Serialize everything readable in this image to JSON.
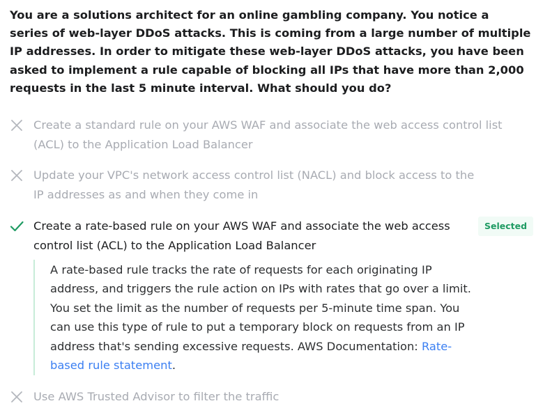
{
  "question": {
    "text": "You are a solutions architect for an online gambling company. You notice a series of web-layer DDoS attacks. This is coming from a large number of multiple IP addresses. In order to mitigate these web-layer DDoS attacks, you have been asked to implement a rule capable of blocking all IPs that have more than 2,000 requests in the last 5 minute interval. What should you do?"
  },
  "options": [
    {
      "icon": "x-icon",
      "status": "incorrect",
      "text": "Create a standard rule on your AWS WAF and associate the web access control list (ACL) to the Application Load Balancer"
    },
    {
      "icon": "x-icon",
      "status": "incorrect",
      "text": "Update your VPC's network access control list (NACL) and block access to the IP addresses as and when they come in"
    },
    {
      "icon": "check-icon",
      "status": "correct",
      "text": "Create a rate-based rule on your AWS WAF and associate the web access control list (ACL) to the Application Load Balancer",
      "badge": "Selected",
      "explanation": {
        "text": "A rate-based rule tracks the rate of requests for each originating IP address, and triggers the rule action on IPs with rates that go over a limit. You set the limit as the number of requests per 5-minute time span. You can use this type of rule to put a temporary block on requests from an IP address that's sending excessive requests. AWS Documentation: ",
        "link_text": "Rate-based rule statement",
        "suffix": "."
      }
    },
    {
      "icon": "x-icon",
      "status": "incorrect",
      "text": "Use AWS Trusted Advisor to filter the traffic"
    }
  ],
  "colors": {
    "incorrect_text": "#a8abb2",
    "correct_check": "#1f9b63",
    "badge_text": "#1f9b63",
    "badge_bg": "#f1fbf6",
    "explanation_border": "#c7ecd8",
    "link": "#3b7ff2"
  }
}
